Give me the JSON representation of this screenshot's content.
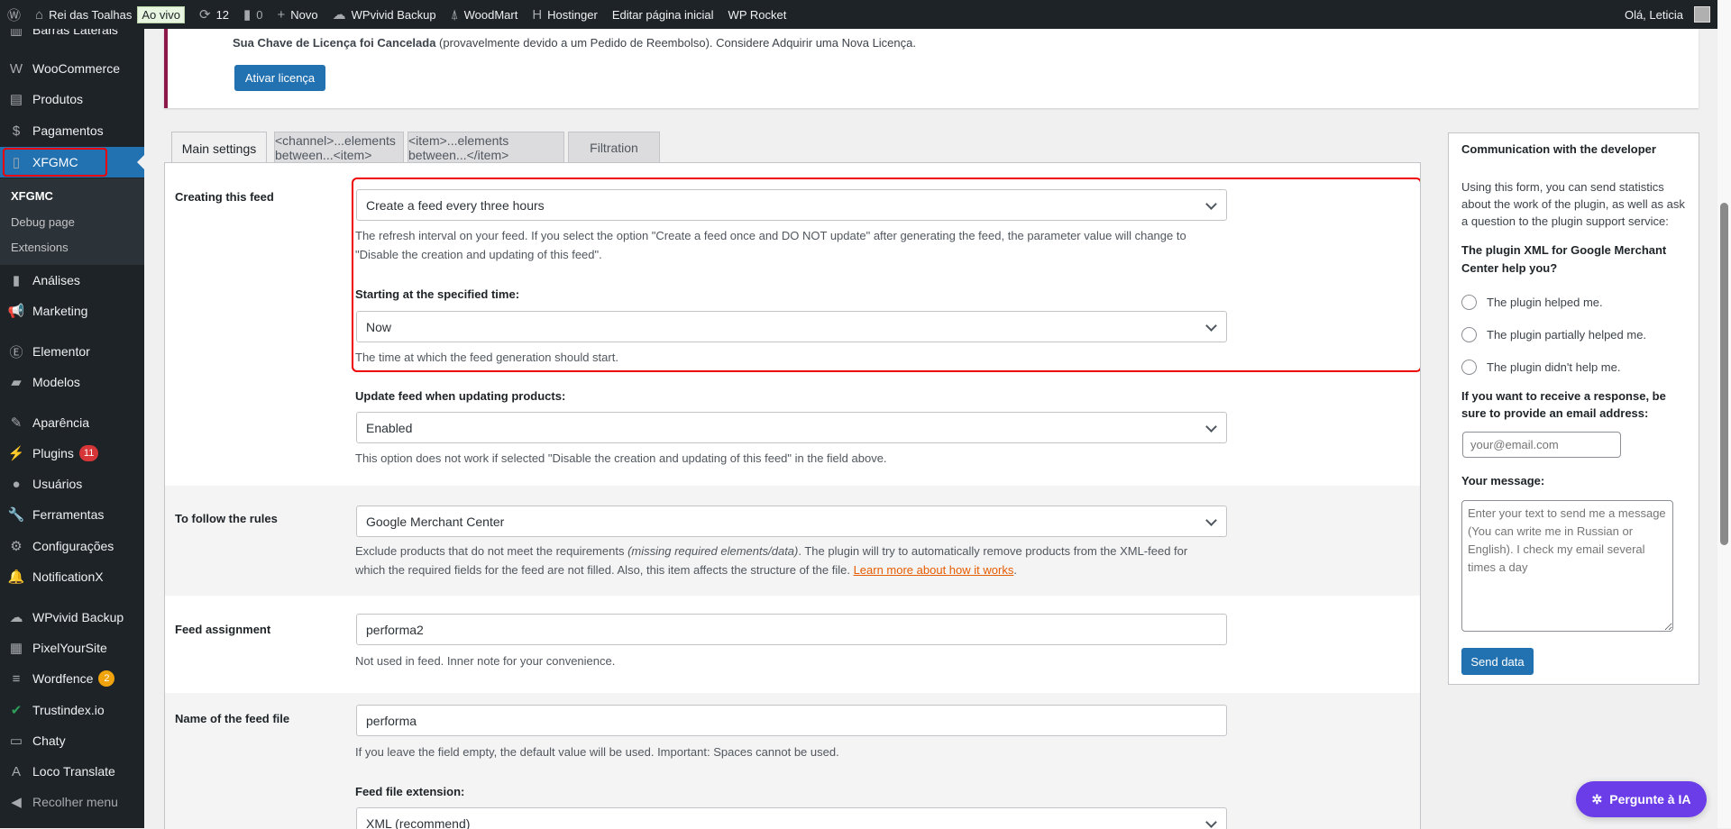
{
  "adminbar": {
    "site": "Rei das Toalhas",
    "live": "Ao vivo",
    "updates": "12",
    "comments": "0",
    "new": "Novo",
    "wpvivid": "WPvivid Backup",
    "woodmart": "WoodMart",
    "hostinger": "Hostinger",
    "edit_home": "Editar página inicial",
    "wprocket": "WP Rocket",
    "greeting": "Olá, Leticia"
  },
  "sidebar": {
    "items": [
      {
        "label": "Barras Laterais",
        "icon": "sidebar-icon"
      },
      {
        "label": "WooCommerce",
        "icon": "woocommerce-icon"
      },
      {
        "label": "Produtos",
        "icon": "archive-icon"
      },
      {
        "label": "Pagamentos",
        "icon": "money-icon"
      },
      {
        "label": "XFGMC",
        "icon": "xml-file-icon",
        "active": true
      },
      {
        "label": "Análises",
        "icon": "chart-bar-icon"
      },
      {
        "label": "Marketing",
        "icon": "megaphone-icon"
      },
      {
        "label": "Elementor",
        "icon": "elementor-icon"
      },
      {
        "label": "Modelos",
        "icon": "folder-icon"
      },
      {
        "label": "Aparência",
        "icon": "brush-icon"
      },
      {
        "label": "Plugins",
        "icon": "plugin-icon",
        "badge": "11",
        "badge_color": "#d63638"
      },
      {
        "label": "Usuários",
        "icon": "user-icon"
      },
      {
        "label": "Ferramentas",
        "icon": "wrench-icon"
      },
      {
        "label": "Configurações",
        "icon": "settings-icon"
      },
      {
        "label": "NotificationX",
        "icon": "bell-icon"
      },
      {
        "label": "WPvivid Backup",
        "icon": "cloud-icon"
      },
      {
        "label": "PixelYourSite",
        "icon": "pixel-icon"
      },
      {
        "label": "Wordfence",
        "icon": "wordfence-icon",
        "badge": "2",
        "badge_color": "#f0a30a"
      },
      {
        "label": "Trustindex.io",
        "icon": "check-circle-icon"
      },
      {
        "label": "Chaty",
        "icon": "chat-icon"
      },
      {
        "label": "Loco Translate",
        "icon": "translate-icon"
      },
      {
        "label": "Recolher menu",
        "icon": "collapse-icon"
      }
    ],
    "submenu": [
      "XFGMC",
      "Debug page",
      "Extensions"
    ]
  },
  "notice": {
    "bold": "Sua Chave de Licença foi Cancelada",
    "text": " (provavelmente devido a um Pedido de Reembolso). Considere Adquirir uma Nova Licença.",
    "button": "Ativar licença"
  },
  "tabs": [
    "Main settings",
    "<channel>...elements between...<item>",
    "<item>...elements between...</item>",
    "Filtration"
  ],
  "settings": {
    "creating": {
      "label": "Creating this feed",
      "value": "Create a feed every three hours",
      "desc": "The refresh interval on your feed. If you select the option \"Create a feed once and DO NOT update\" after generating the feed, the parameter value will change to \"Disable the creation and updating of this feed\".",
      "start_label": "Starting at the specified time:",
      "start_value": "Now",
      "start_desc": "The time at which the feed generation should start.",
      "update_label": "Update feed when updating products:",
      "update_value": "Enabled",
      "update_desc": "This option does not work if selected \"Disable the creation and updating of this feed\" in the field above."
    },
    "rules": {
      "label": "To follow the rules",
      "value": "Google Merchant Center",
      "desc1": "Exclude products that do not meet the requirements ",
      "desc_italic": "(missing required elements/data)",
      "desc2": ". The plugin will try to automatically remove products from the XML-feed for which the required fields for the feed are not filled. Also, this item affects the structure of the file. ",
      "link": "Learn more about how it works",
      "end": "."
    },
    "assignment": {
      "label": "Feed assignment",
      "value": "performa2",
      "desc": "Not used in feed. Inner note for your convenience."
    },
    "filename": {
      "label": "Name of the feed file",
      "value": "performa",
      "desc": "If you leave the field empty, the default value will be used. Important: Spaces cannot be used.",
      "ext_label": "Feed file extension:",
      "ext_value": "XML (recommend)"
    }
  },
  "developer": {
    "title": "Communication with the developer",
    "intro": "Using this form, you can send statistics about the work of the plugin, as well as ask a question to the plugin support service:",
    "question": "The plugin XML for Google Merchant Center help you?",
    "options": [
      "The plugin helped me.",
      "The plugin partially helped me.",
      "The plugin didn't help me."
    ],
    "email_label": "If you want to receive a response, be sure to provide an email address:",
    "email_placeholder": "your@email.com",
    "message_label": "Your message:",
    "message_placeholder": "Enter your text to send me a message (You can write me in Russian or English). I check my email several times a day",
    "send": "Send data"
  },
  "ai_button": "Pergunte à IA"
}
